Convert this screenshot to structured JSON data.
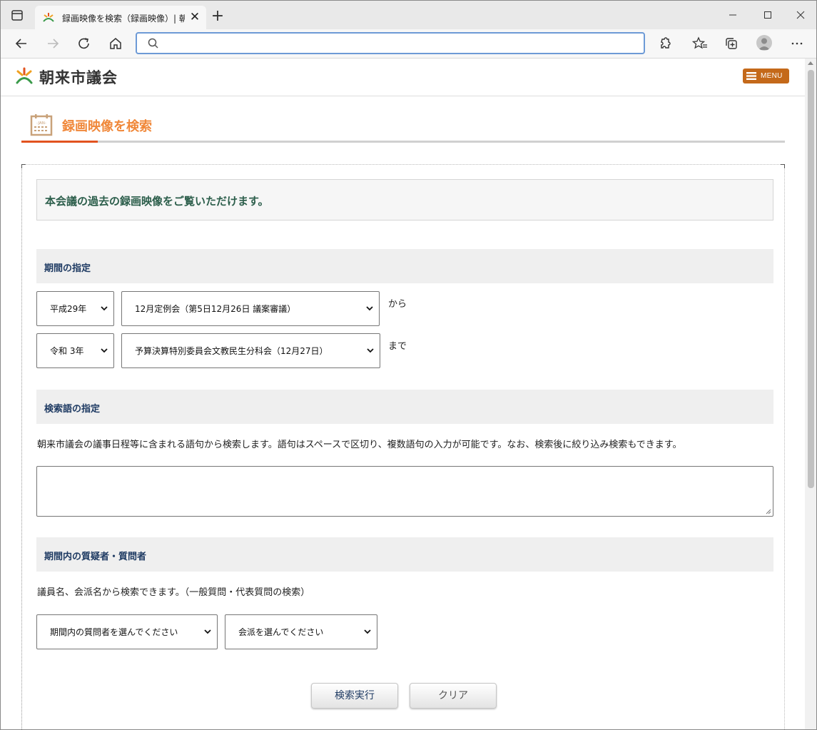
{
  "browser": {
    "tab_title": "録画映像を検索（録画映像）| 朝",
    "address_value": "",
    "address_placeholder": ""
  },
  "site": {
    "logo_text": "朝来市議会",
    "menu_label": "MENU"
  },
  "page": {
    "title": "録画映像を検索",
    "calendar_icon_text": "-JAN-",
    "intro": "本会議の過去の録画映像をご覧いただけます。"
  },
  "period": {
    "heading": "期間の指定",
    "from_year": "平成29年",
    "from_session": "12月定例会（第5日12月26日 議案審議）",
    "from_suffix": "から",
    "to_year": "令和 3年",
    "to_session": "予算決算特別委員会文教民生分科会（12月27日）",
    "to_suffix": "まで"
  },
  "keyword": {
    "heading": "検索語の指定",
    "description": "朝来市議会の議事日程等に含まれる語句から検索します。語句はスペースで区切り、複数語句の入力が可能です。なお、検索後に絞り込み検索もできます。",
    "value": ""
  },
  "questioner": {
    "heading": "期間内の質疑者・質問者",
    "description": "議員名、会派名から検索できます。（一般質問・代表質問の検索）",
    "member_select": "期間内の質問者を選んでください",
    "faction_select": "会派を選んでください"
  },
  "actions": {
    "search_label": "検索実行",
    "clear_label": "クリア"
  },
  "colors": {
    "accent_orange": "#f0883a",
    "accent_red": "#e2531f",
    "menu_brown": "#c4691a",
    "heading_navy": "#1f3b63",
    "intro_green": "#2c5e4b"
  }
}
